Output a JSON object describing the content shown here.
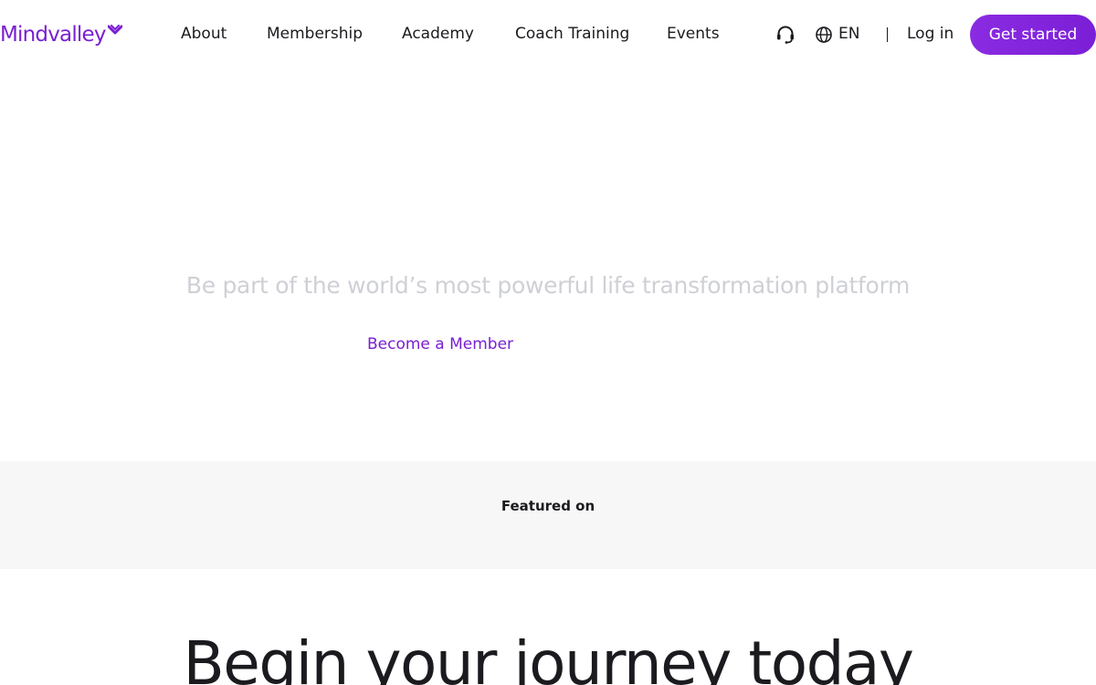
{
  "brand": {
    "name": "Mindvalley",
    "accent": "#7a1fd1",
    "text_color": "#1b1b1f",
    "muted_text": "#cfd0d6",
    "band_bg": "#f7f7f7"
  },
  "nav": {
    "items": [
      {
        "label": "About"
      },
      {
        "label": "Membership"
      },
      {
        "label": "Academy"
      },
      {
        "label": "Coach Training"
      },
      {
        "label": "Events"
      }
    ],
    "support_icon": "headset-icon",
    "language_icon": "globe-icon",
    "language": "EN",
    "login_label": "Log in",
    "cta_label": "Get started"
  },
  "hero": {
    "subtitle": "Be part of the world’s most powerful life transformation platform",
    "link_label": "Become a Member"
  },
  "featured": {
    "label": "Featured on"
  },
  "journey": {
    "heading": "Begin your journey today"
  }
}
